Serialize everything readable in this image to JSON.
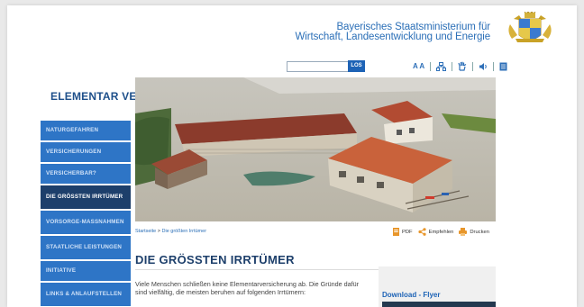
{
  "header": {
    "ministry_line1": "Bayerisches Staatsministerium für",
    "ministry_line2": "Wirtschaft, Landesentwicklung und Energie",
    "crest_icon": "bavarian-crest-icon"
  },
  "search": {
    "button_label": "LOS",
    "placeholder": ""
  },
  "tools": {
    "font_size_label": "A A"
  },
  "site_title": "ELEMENTAR VERSICHERN",
  "nav": {
    "items": [
      {
        "label": "NATURGEFAHREN"
      },
      {
        "label": "VERSICHERUNGEN"
      },
      {
        "label": "VERSICHERBAR?"
      },
      {
        "label": "DIE GRÖSSTEN IRRTÜMER"
      },
      {
        "label": "VORSORGE-MASSNAHMEN"
      },
      {
        "label": "STAATLICHE LEISTUNGEN"
      },
      {
        "label": "INITIATIVE"
      },
      {
        "label": "LINKS & ANLAUFSTELLEN"
      }
    ]
  },
  "breadcrumb": {
    "home": "Startseite",
    "separator": ">",
    "current": "Die größten Irrtümer"
  },
  "actions": {
    "pdf": "PDF",
    "share": "Empfehlen",
    "print": "Drucken"
  },
  "main": {
    "title": "DIE GRÖSSTEN IRRTÜMER",
    "intro": "Viele Menschen schließen keine Elementarversicherung ab. Die Gründe dafür sind vielfältig, die meisten beruhen auf folgenden Irrtümern:"
  },
  "sidebar_box": {
    "label": "Download - Flyer"
  },
  "colors": {
    "brand_blue": "#2e75c6",
    "nav_active": "#1d3f6b",
    "ministry_blue": "#2b6fb7"
  }
}
